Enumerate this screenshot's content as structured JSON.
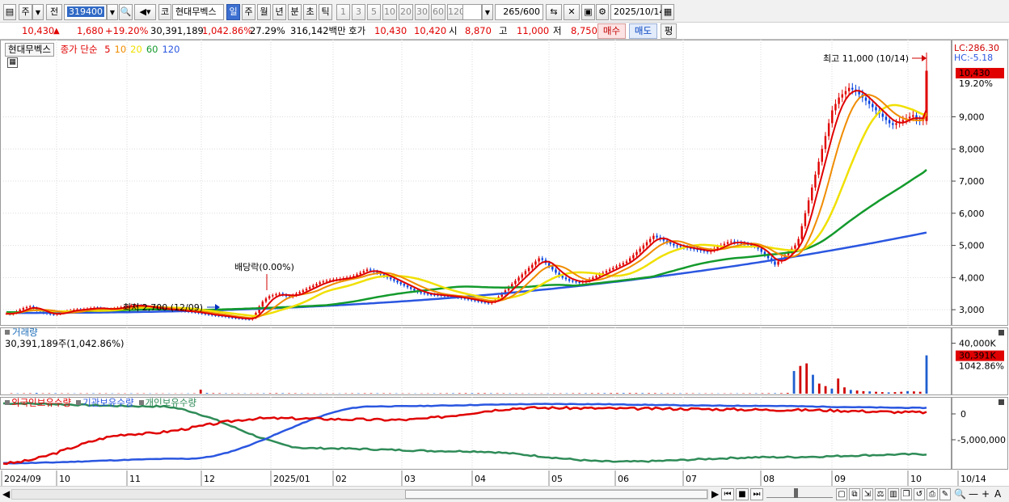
{
  "toolbar": {
    "period_jo": "주",
    "jeon": "전",
    "code": "319400",
    "ko": "코",
    "stock_name": "현대무벡스",
    "periods": [
      {
        "label": "일",
        "active": true
      },
      {
        "label": "주",
        "active": false
      },
      {
        "label": "월",
        "active": false
      },
      {
        "label": "년",
        "active": false
      },
      {
        "label": "분",
        "active": false
      },
      {
        "label": "초",
        "active": false
      },
      {
        "label": "틱",
        "active": false
      }
    ],
    "intervals": [
      "1",
      "3",
      "5",
      "10",
      "20",
      "30",
      "60",
      "120"
    ],
    "count_value": "265",
    "count_max": "/600",
    "date": "2025/10/14"
  },
  "quote": {
    "price": "10,430",
    "change": "1,680",
    "change_pct": "+19.20%",
    "volume": "30,391,189",
    "volume_pct": "1,042.86%",
    "turnover": "27.29%",
    "amount": "316,142백만",
    "hoga_label": "호가",
    "ask": "10,430",
    "bid": "10,420",
    "open_label": "시",
    "open": "8,870",
    "high_label": "고",
    "high": "11,000",
    "low_label": "저",
    "low": "8,750",
    "buy_label": "매수",
    "sell_label": "매도",
    "pyeong_label": "평"
  },
  "price_panel": {
    "stock_label": "현대무벡스",
    "ma_label": "종가 단순",
    "ma_periods": [
      {
        "label": "5",
        "color": "#e00000"
      },
      {
        "label": "10",
        "color": "#f08c00"
      },
      {
        "label": "20",
        "color": "#f0e000"
      },
      {
        "label": "60",
        "color": "#139a2c"
      },
      {
        "label": "120",
        "color": "#2a56e0"
      }
    ],
    "lc_label": "LC:286.30",
    "hc_label": "HC:-5.18",
    "last_price_tag": "10,430",
    "last_pct_tag": "19.20%",
    "high_annotation": "최고 11,000 (10/14)",
    "low_annotation": "최저 2,700 (12/09)",
    "dividend_annotation": "배당락(0.00%)",
    "y_ticks": [
      "9,000",
      "8,000",
      "7,000",
      "6,000",
      "5,000",
      "4,000",
      "3,000"
    ]
  },
  "volume_panel": {
    "title": "거래량",
    "subtitle": "30,391,189주(1,042.86%)",
    "y_tick": "40,000K",
    "last_tag": "30,391K",
    "last_pct_tag": "1042.86%"
  },
  "holdings_panel": {
    "series": [
      {
        "label": "외국인보유수량",
        "color": "#e00000"
      },
      {
        "label": "기관보유수량",
        "color": "#2a56e0"
      },
      {
        "label": "개인보유수량",
        "color": "#2e8b57"
      }
    ],
    "y_ticks": [
      "0",
      "-5,000,000"
    ]
  },
  "x_axis": {
    "labels": [
      "2024/09",
      "10",
      "11",
      "12",
      "2025/01",
      "02",
      "03",
      "04",
      "05",
      "06",
      "07",
      "08",
      "09",
      "10",
      "10/14"
    ]
  },
  "chart_data": {
    "type": "line",
    "x_range": [
      "2024/09",
      "2025/10/14"
    ],
    "ylim_price": [
      2500,
      11200
    ],
    "candles_last": {
      "open": 8870,
      "high": 11000,
      "low": 8750,
      "close": 10430
    },
    "price_series": {
      "close": [
        2880,
        2860,
        2900,
        2950,
        3000,
        3050,
        3080,
        3100,
        3050,
        2980,
        2950,
        2900,
        2880,
        2860,
        2850,
        2870,
        2900,
        2930,
        2960,
        2980,
        3000,
        3010,
        2990,
        3020,
        3030,
        3050,
        3060,
        3050,
        3030,
        3020,
        3000,
        3020,
        3040,
        3060,
        3080,
        3100,
        3120,
        3140,
        3150,
        3130,
        3110,
        3090,
        3080,
        3060,
        3040,
        3030,
        3020,
        3010,
        3000,
        2990,
        2980,
        2970,
        2960,
        2950,
        2940,
        2930,
        2920,
        2900,
        2880,
        2860,
        2850,
        2830,
        2820,
        2810,
        2800,
        2780,
        2760,
        2750,
        2740,
        2730,
        2720,
        2710,
        2700,
        2750,
        2900,
        3100,
        3250,
        3350,
        3420,
        3450,
        3480,
        3500,
        3460,
        3420,
        3400,
        3450,
        3500,
        3550,
        3600,
        3650,
        3700,
        3750,
        3800,
        3850,
        3880,
        3900,
        3920,
        3940,
        3950,
        3960,
        3980,
        4000,
        4020,
        4050,
        4100,
        4150,
        4200,
        4250,
        4220,
        4180,
        4150,
        4100,
        4050,
        4000,
        3950,
        3900,
        3850,
        3800,
        3750,
        3700,
        3650,
        3600,
        3550,
        3520,
        3500,
        3480,
        3470,
        3460,
        3450,
        3440,
        3430,
        3420,
        3410,
        3400,
        3380,
        3360,
        3340,
        3320,
        3300,
        3280,
        3260,
        3240,
        3220,
        3200,
        3250,
        3300,
        3400,
        3500,
        3600,
        3700,
        3800,
        3900,
        4000,
        4100,
        4200,
        4300,
        4400,
        4500,
        4600,
        4550,
        4450,
        4350,
        4250,
        4150,
        4050,
        4000,
        3950,
        3900,
        3880,
        3860,
        3850,
        3870,
        3900,
        3950,
        4000,
        4050,
        4100,
        4150,
        4200,
        4250,
        4300,
        4350,
        4400,
        4450,
        4500,
        4600,
        4700,
        4800,
        4900,
        5000,
        5100,
        5200,
        5300,
        5250,
        5200,
        5150,
        5100,
        5050,
        5000,
        4980,
        4960,
        4940,
        4920,
        4900,
        4880,
        4860,
        4840,
        4820,
        4800,
        4850,
        4900,
        4950,
        5000,
        5050,
        5100,
        5120,
        5100,
        5080,
        5060,
        5040,
        5020,
        5000,
        4980,
        4900,
        4800,
        4700,
        4600,
        4500,
        4400,
        4500,
        4600,
        4700,
        4800,
        4900,
        5000,
        5200,
        5600,
        6000,
        6400,
        6800,
        7200,
        7600,
        8000,
        8400,
        8800,
        9200,
        9400,
        9600,
        9700,
        9800,
        9900,
        9850,
        9800,
        9700,
        9600,
        9500,
        9400,
        9300,
        9200,
        9100,
        9000,
        8900,
        8800,
        8750,
        8800,
        8850,
        8900,
        8950,
        9000,
        9050,
        8900,
        8870,
        8950,
        10430
      ],
      "ma120_endpoints": {
        "start": 2900,
        "end": 5400
      },
      "ma60_endpoints": {
        "start": 2950,
        "end": 6450
      }
    },
    "volume_series_k": [
      300,
      250,
      280,
      320,
      600,
      280,
      300,
      350,
      260,
      240,
      220,
      260,
      250,
      300,
      280,
      250,
      240,
      230,
      220,
      260,
      250,
      240,
      230,
      220,
      210,
      200,
      190,
      180,
      220,
      260,
      3200,
      600,
      400,
      350,
      300,
      280,
      260,
      240,
      230,
      250,
      300,
      350,
      400,
      380,
      320,
      300,
      280,
      260,
      240,
      220,
      200,
      210,
      230,
      250,
      280,
      300,
      320,
      350,
      320,
      300,
      280,
      260,
      240,
      220,
      200,
      220,
      250,
      280,
      300,
      320,
      350,
      380,
      400,
      420,
      400,
      380,
      350,
      320,
      300,
      280,
      260,
      240,
      220,
      200,
      220,
      240,
      260,
      280,
      300,
      320,
      340,
      360,
      380,
      400,
      420,
      440,
      460,
      500,
      480,
      460,
      440,
      420,
      400,
      380,
      360,
      340,
      320,
      300,
      280,
      260,
      240,
      220,
      200,
      220,
      240,
      260,
      280,
      300,
      320,
      340,
      360,
      380,
      400,
      600,
      18000,
      22000,
      24000,
      15000,
      8000,
      6000,
      4000,
      12000,
      5000,
      3000,
      2500,
      2000,
      1800,
      1500,
      1200,
      1000,
      1200,
      1500,
      2000,
      1800,
      1500,
      30391
    ],
    "holdings_series": {
      "foreign": [
        -1,
        -0.02,
        0.5,
        0.45,
        0.85,
        0.82,
        0.78,
        0.7
      ],
      "institution": [
        -1,
        -0.85,
        0.9,
        0.98,
        0.92,
        0.85
      ],
      "individual": [
        1,
        0.9,
        -0.5,
        -0.6,
        -0.95,
        -0.8,
        -0.7
      ]
    }
  }
}
